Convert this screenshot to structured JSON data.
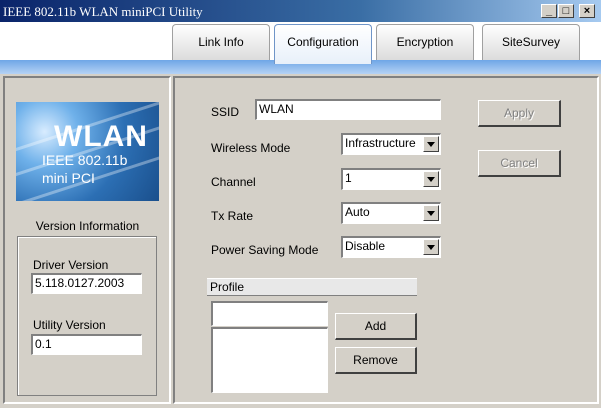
{
  "window": {
    "title": "IEEE 802.11b WLAN miniPCI Utility",
    "controls": {
      "minimize": "_",
      "maximize": "□",
      "close": "×"
    }
  },
  "tabs": [
    {
      "label": "Link Info",
      "active": false
    },
    {
      "label": "Configuration",
      "active": true
    },
    {
      "label": "Encryption",
      "active": false
    },
    {
      "label": "SiteSurvey",
      "active": false
    }
  ],
  "sidebar": {
    "logo": {
      "main": "WLAN",
      "line1": "IEEE 802.11b",
      "line2": "mini PCI"
    },
    "version_title": "Version Information",
    "driver_label": "Driver Version",
    "driver_value": "5.118.0127.2003",
    "utility_label": "Utility Version",
    "utility_value": "0.1"
  },
  "config": {
    "ssid_label": "SSID",
    "ssid_value": "WLAN",
    "mode_label": "Wireless Mode",
    "mode_value": "Infrastructure",
    "channel_label": "Channel",
    "channel_value": "1",
    "txrate_label": "Tx Rate",
    "txrate_value": "Auto",
    "power_label": "Power Saving Mode",
    "power_value": "Disable"
  },
  "buttons": {
    "apply": "Apply",
    "cancel": "Cancel",
    "add": "Add",
    "remove": "Remove"
  },
  "profile": {
    "heading": "Profile",
    "name_value": "",
    "items": []
  }
}
